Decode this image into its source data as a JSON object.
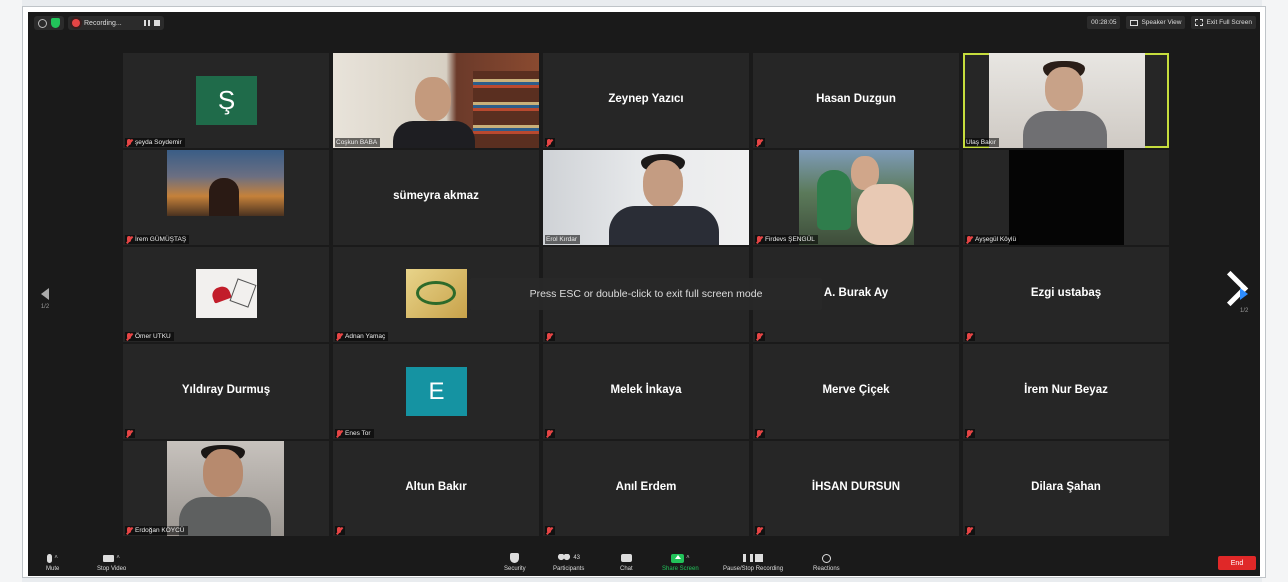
{
  "topbar": {
    "recording_label": "Recording...",
    "timer": "00:28:05",
    "speaker_view_label": "Speaker View",
    "exit_fullscreen_label": "Exit Full Screen"
  },
  "participants": [
    {
      "name": "şeyda Soydemir",
      "avatar": "Ş",
      "display": "avatar"
    },
    {
      "name": "Coşkun BABA",
      "display": "video"
    },
    {
      "name": "Zeynep Yazıcı",
      "display": "name"
    },
    {
      "name": "Hasan Duzgun",
      "display": "name"
    },
    {
      "name": "Ulaş Bakır",
      "display": "video",
      "active_speaker": true
    },
    {
      "name": "İrem GÜMÜŞTAŞ",
      "display": "photo"
    },
    {
      "name": "sümeyra akmaz",
      "display": "name"
    },
    {
      "name": "Erol Kırdar",
      "display": "video"
    },
    {
      "name": "Firdevs ŞENGÜL",
      "display": "photo"
    },
    {
      "name": "Ayşegül Köylü",
      "display": "video"
    },
    {
      "name": "Ömer UTKU",
      "display": "photo"
    },
    {
      "name": "Adnan Yamaç",
      "display": "photo"
    },
    {
      "name": "",
      "display": "blank"
    },
    {
      "name": "A. Burak Ay",
      "display": "name"
    },
    {
      "name": "Ezgi ustabaş",
      "display": "name"
    },
    {
      "name": "Yıldıray Durmuş",
      "display": "name"
    },
    {
      "name": "Enes Tor",
      "avatar": "E",
      "display": "avatar"
    },
    {
      "name": "Melek İnkaya",
      "display": "name"
    },
    {
      "name": "Merve Çiçek",
      "display": "name"
    },
    {
      "name": "İrem Nur Beyaz",
      "display": "name"
    },
    {
      "name": "Erdoğan KÖYCÜ",
      "display": "photo"
    },
    {
      "name": "Altun Bakır",
      "display": "name"
    },
    {
      "name": "Anıl Erdem",
      "display": "name"
    },
    {
      "name": "İHSAN DURSUN",
      "display": "name"
    },
    {
      "name": "Dilara Şahan",
      "display": "name"
    }
  ],
  "toast": "Press ESC or double-click to exit full screen mode",
  "pagination": {
    "left": "1/2",
    "right": "1/2"
  },
  "toolbar": {
    "mute": "Mute",
    "stop_video": "Stop Video",
    "security": "Security",
    "participants": "Participants",
    "participants_count": "43",
    "chat": "Chat",
    "share_screen": "Share Screen",
    "recording": "Pause/Stop Recording",
    "reactions": "Reactions",
    "end": "End"
  },
  "colors": {
    "active_speaker_border": "#c6dd3d",
    "share_green": "#22c35a",
    "end_red": "#e02828",
    "muted_red": "#e64545"
  }
}
